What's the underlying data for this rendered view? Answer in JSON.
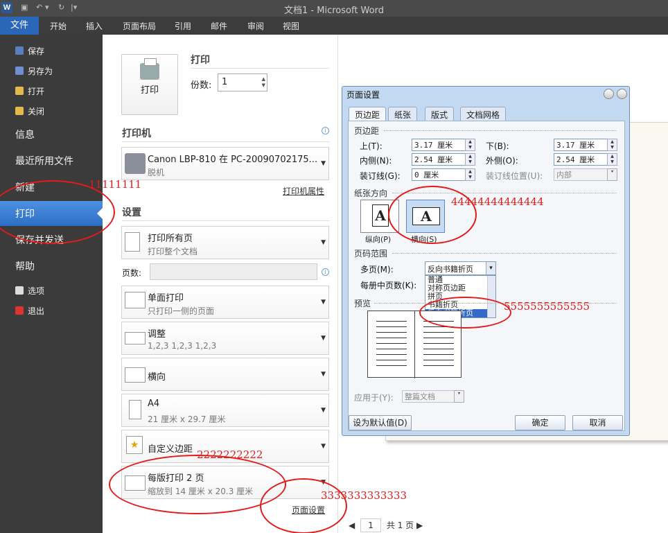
{
  "window": {
    "title": "文档1 - Microsoft Word",
    "logo": "W"
  },
  "ribbon": {
    "file_tab": "文件",
    "tabs": [
      "开始",
      "插入",
      "页面布局",
      "引用",
      "邮件",
      "审阅",
      "视图"
    ]
  },
  "nav": {
    "save": "保存",
    "save_as": "另存为",
    "open": "打开",
    "close": "关闭",
    "info": "信息",
    "recent": "最近所用文件",
    "new": "新建",
    "print": "打印",
    "save_send": "保存并发送",
    "help": "帮助",
    "options": "选项",
    "exit": "退出"
  },
  "print": {
    "button": "打印",
    "heading": "打印",
    "copies_label": "份数:",
    "copies_value": "1",
    "printer_heading": "打印机",
    "printer_name": "Canon LBP-810 在 PC-20090702175...",
    "printer_status": "脱机",
    "printer_props": "打印机属性",
    "settings_heading": "设置",
    "pages_label": "页数:",
    "settings": [
      {
        "l1": "打印所有页",
        "l2": "打印整个文档"
      },
      {
        "l1": "单面打印",
        "l2": "只打印一侧的页面"
      },
      {
        "l1": "调整",
        "l2": "1,2,3    1,2,3    1,2,3"
      },
      {
        "l1": "横向",
        "l2": ""
      },
      {
        "l1": "A4",
        "l2": "21 厘米 x 29.7 厘米"
      },
      {
        "l1": "自定义边距",
        "l2": ""
      },
      {
        "l1": "每版打印 2 页",
        "l2": "缩放到 14 厘米 x 20.3 厘米"
      }
    ],
    "page_setup_link": "页面设置"
  },
  "pager": {
    "current": "1",
    "total": "共 1 页"
  },
  "dialog": {
    "title": "页面设置",
    "tabs": [
      "页边距",
      "纸张",
      "版式",
      "文档网格"
    ],
    "margins_group": "页边距",
    "top_label": "上(T):",
    "top_value": "3.17 厘米",
    "bottom_label": "下(B):",
    "bottom_value": "3.17 厘米",
    "inner_label": "内侧(N):",
    "inner_value": "2.54 厘米",
    "outer_label": "外侧(O):",
    "outer_value": "2.54 厘米",
    "gutter_label": "装订线(G):",
    "gutter_value": "0 厘米",
    "gutter_pos_label": "装订线位置(U):",
    "gutter_pos_value": "内部",
    "orientation_group": "纸张方向",
    "portrait": "纵向(P)",
    "landscape": "横向(S)",
    "pages_group": "页码范围",
    "multi_label": "多页(M):",
    "multi_value": "反向书籍折页",
    "multi_options": [
      "普通",
      "对称页边距",
      "拼页",
      "书籍折页",
      "反向书籍折页"
    ],
    "sheets_label": "每册中页数(K):",
    "preview_group": "预览",
    "apply_label": "应用于(Y):",
    "apply_value": "整篇文档",
    "default_btn": "设为默认值(D)",
    "ok_btn": "确定",
    "cancel_btn": "取消"
  },
  "annotations": {
    "a1": "11111111",
    "a2": "2222222222",
    "a3": "3333333333333",
    "a4": "44444444444444",
    "a5": "5555555555555"
  }
}
